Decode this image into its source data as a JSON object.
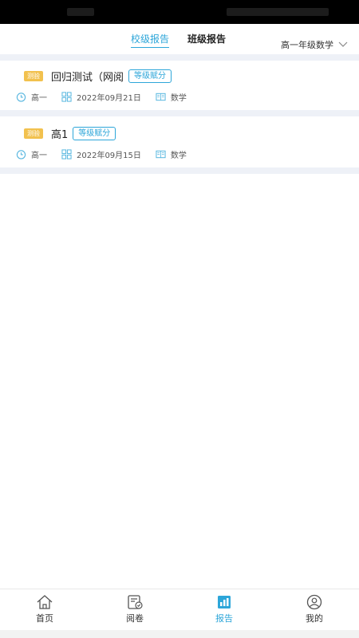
{
  "header": {
    "tabs": [
      {
        "label": "校级报告",
        "active": true
      },
      {
        "label": "班级报告",
        "active": false
      }
    ],
    "grade_subject": "高一年级数学"
  },
  "reports": [
    {
      "type_badge": "测验",
      "title": "回归测试（网阅",
      "tag": "等级赋分",
      "grade": "高一",
      "date": "2022年09月21日",
      "subject": "数学"
    },
    {
      "type_badge": "测验",
      "title": "高1",
      "tag": "等级赋分",
      "grade": "高一",
      "date": "2022年09月15日",
      "subject": "数学"
    }
  ],
  "tabbar": [
    {
      "label": "首页",
      "icon": "home-icon",
      "active": false
    },
    {
      "label": "阅卷",
      "icon": "grading-icon",
      "active": false
    },
    {
      "label": "报告",
      "icon": "report-icon",
      "active": true
    },
    {
      "label": "我的",
      "icon": "profile-icon",
      "active": false
    }
  ],
  "colors": {
    "accent": "#2da6d9",
    "badge": "#f2c14e",
    "divider": "#eef1f7"
  }
}
